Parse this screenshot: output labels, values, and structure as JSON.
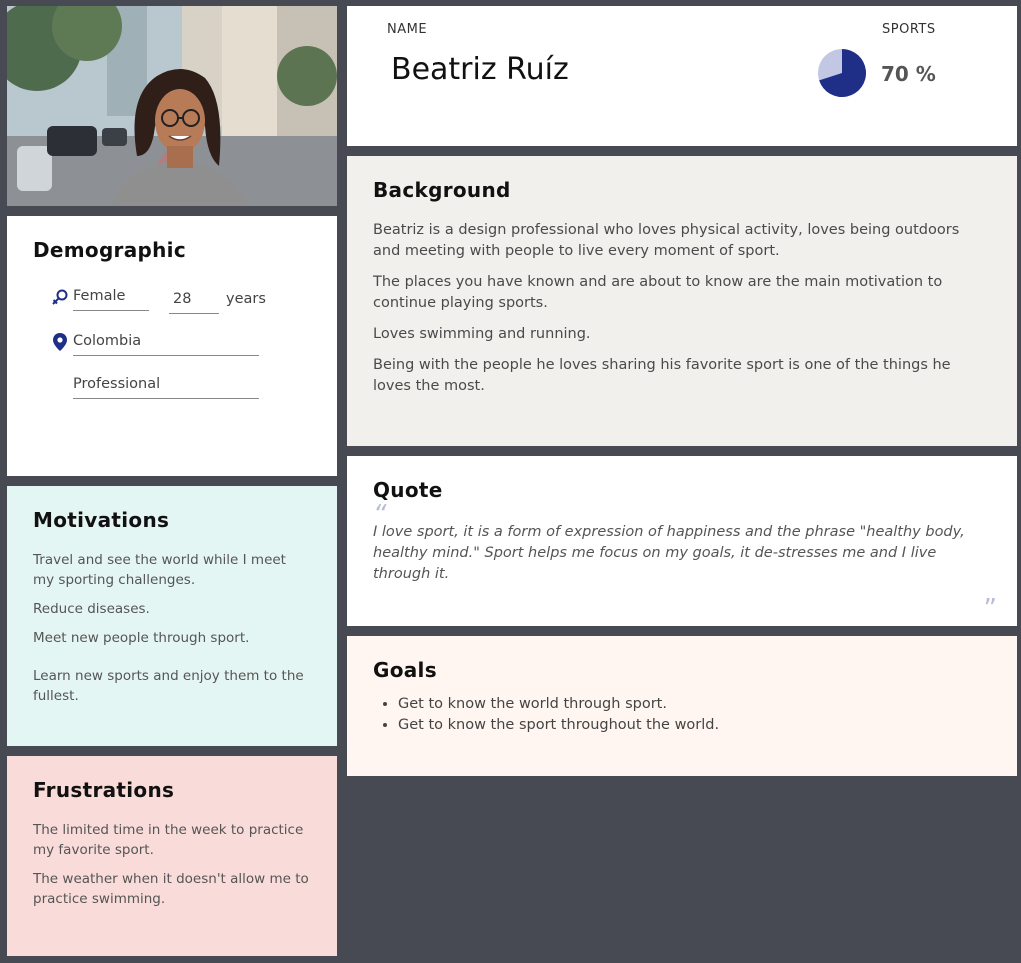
{
  "header": {
    "name_label": "NAME",
    "name": "Beatriz Ruíz",
    "sports_label": "SPORTS",
    "sports_value": "70 %",
    "sports_fraction": 0.7,
    "pie_colors": {
      "fill": "#1f2f87",
      "rest": "#c2c7e3"
    }
  },
  "demographic": {
    "title": "Demographic",
    "gender": "Female",
    "age": "28",
    "age_unit": "years",
    "location": "Colombia",
    "occupation": "Professional",
    "icons": {
      "gender": "female-symbol-icon",
      "location": "map-pin-icon"
    },
    "icon_color": "#1f2f87"
  },
  "motivations": {
    "title": "Motivations",
    "items": [
      "Travel and see the world while I meet my sporting challenges.",
      "Reduce diseases.",
      "Meet new people through sport.",
      "Learn new sports and enjoy them to the fullest."
    ]
  },
  "frustrations": {
    "title": "Frustrations",
    "items": [
      "The limited time in the week to practice my favorite sport.",
      "The weather when it doesn't allow me to practice swimming."
    ]
  },
  "background": {
    "title": "Background",
    "paragraphs": [
      "Beatriz is a design professional who loves physical activity, loves being outdoors and meeting with people to live every moment of sport.",
      "The places you have known and are about to know are the main motivation to continue playing sports.",
      "Loves swimming and running.",
      "Being with the people he loves sharing his favorite sport is one of the things he loves the most."
    ]
  },
  "quote": {
    "title": "Quote",
    "open_mark": "“",
    "close_mark": "”",
    "text": "I love sport, it is a form of expression of happiness and the phrase \"healthy body, healthy mind.\" Sport helps me focus on my goals, it de-stresses me and I live through it."
  },
  "goals": {
    "title": "Goals",
    "items": [
      "Get to know the world through sport.",
      "Get to know the sport throughout the world."
    ]
  },
  "colors": {
    "page_bg": "#474a53",
    "background_card": "#f1f0ed",
    "motivations_card": "#e4f6f3",
    "frustrations_card": "#f9dcd9",
    "goals_card": "#fff6f1"
  }
}
